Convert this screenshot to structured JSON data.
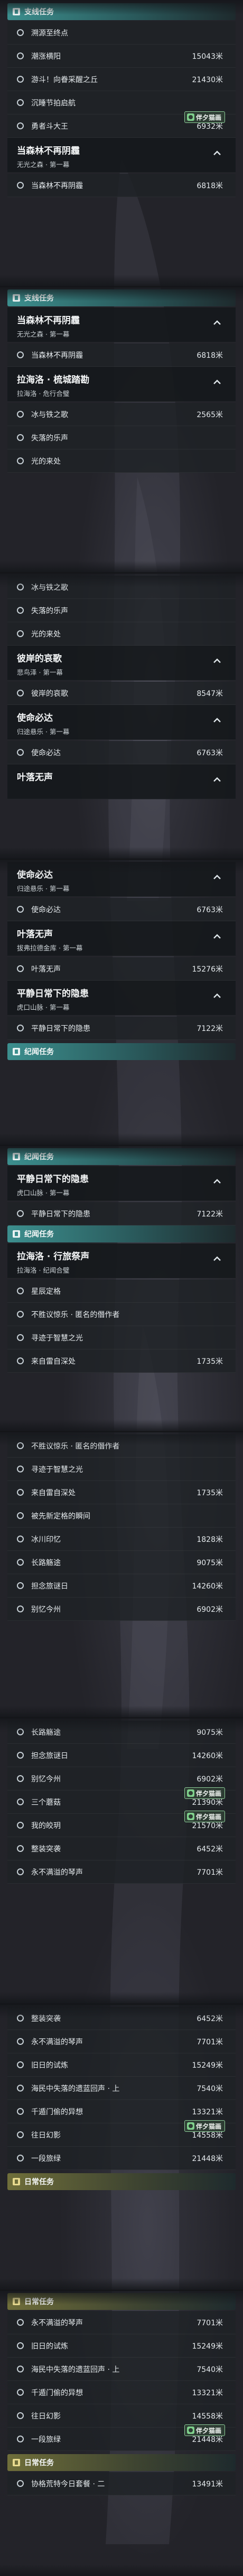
{
  "labels": {
    "sec_side": "支线任务",
    "sec_legend": "纪闻任务",
    "sec_daily": "日常任务"
  },
  "shots": [
    {
      "items": [
        {
          "name": "溯源至终点",
          "dist": ""
        },
        {
          "name": "潮涨横阳",
          "dist": "15043米"
        },
        {
          "name": "游斗！向眷采醒之丘",
          "dist": "21430米"
        },
        {
          "name": "沉睡节拍启航",
          "dist": ""
        },
        {
          "name": "勇者斗大王",
          "dist": "6932米",
          "badge": "伴夕猫画"
        }
      ],
      "section": "sec_side",
      "quest": {
        "title": "当森林不再阴霾",
        "sub": "无光之森 · 第一幕"
      },
      "after": [
        {
          "name": "当森林不再阴霾",
          "dist": "6818米"
        }
      ]
    },
    {
      "section": "sec_side",
      "quests": [
        {
          "title": "当森林不再阴霾",
          "sub": "无光之森 · 第一幕",
          "items": [
            {
              "name": "当森林不再阴霾",
              "dist": "6818米"
            }
          ]
        },
        {
          "title": "拉海洛 · 梳城踏勘",
          "sub": "拉海洛 · 危行合璧",
          "items": [
            {
              "name": "冰与铁之歌",
              "dist": "2565米"
            },
            {
              "name": "失落的乐声",
              "dist": ""
            },
            {
              "name": "光的来处",
              "dist": ""
            }
          ]
        }
      ]
    },
    {
      "items": [
        {
          "name": "冰与铁之歌",
          "dist": ""
        },
        {
          "name": "失落的乐声",
          "dist": ""
        },
        {
          "name": "光的来处",
          "dist": ""
        }
      ],
      "quests": [
        {
          "title": "彼岸的哀歌",
          "sub": "悲鸟泽 · 第一幕",
          "items": [
            {
              "name": "彼岸的哀歌",
              "dist": "8547米"
            }
          ]
        },
        {
          "title": "使命必达",
          "sub": "归途悬乐 · 第一幕",
          "items": [
            {
              "name": "使命必达",
              "dist": "6763米"
            }
          ]
        },
        {
          "title": "叶落无声",
          "sub": "",
          "items": []
        }
      ]
    },
    {
      "quests": [
        {
          "title": "使命必达",
          "sub": "归途悬乐 · 第一幕",
          "items": [
            {
              "name": "使命必达",
              "dist": "6763米"
            }
          ]
        },
        {
          "title": "叶落无声",
          "sub": "拔弗拉德金库 · 第一幕",
          "items": [
            {
              "name": "叶落无声",
              "dist": "15276米"
            }
          ]
        },
        {
          "title": "平静日常下的隐患",
          "sub": "虎口山脉 · 第一幕",
          "items": [
            {
              "name": "平静日常下的隐患",
              "dist": "7122米"
            }
          ]
        }
      ],
      "section_end": "sec_legend"
    },
    {
      "section": "sec_legend",
      "quests": [
        {
          "title": "平静日常下的隐患",
          "sub": "虎口山脉 · 第一幕",
          "items": [
            {
              "name": "平静日常下的隐患",
              "dist": "7122米"
            }
          ]
        }
      ],
      "section2": "sec_legend",
      "quest2": {
        "title": "拉海洛 · 行旅祭声",
        "sub": "拉海洛 · 纪闻合璧"
      },
      "items2": [
        {
          "name": "星辰定格",
          "dist": ""
        },
        {
          "name": "不胜议惊乐 · 匿名的僭作者",
          "dist": ""
        },
        {
          "name": "寻迹于智慧之光",
          "dist": ""
        },
        {
          "name": "来自雷自深处",
          "dist": "1735米"
        }
      ]
    },
    {
      "items": [
        {
          "name": "不胜议惊乐 · 匿名的僭作者",
          "dist": ""
        },
        {
          "name": "寻迹于智慧之光",
          "dist": ""
        },
        {
          "name": "来自雷自深处",
          "dist": "1735米"
        },
        {
          "name": "被先新定格的瞬间",
          "dist": ""
        },
        {
          "name": "冰川印忆",
          "dist": "1828米"
        },
        {
          "name": "长路觞途",
          "dist": "9075米"
        },
        {
          "name": "担念旅谜日",
          "dist": "14260米"
        },
        {
          "name": "别忆今州",
          "dist": "6902米"
        }
      ]
    },
    {
      "items": [
        {
          "name": "长路觞途",
          "dist": "9075米"
        },
        {
          "name": "担念旅谜日",
          "dist": "14260米"
        },
        {
          "name": "别忆今州",
          "dist": "6902米"
        },
        {
          "name": "三个蘑菇",
          "dist": "21390米",
          "badge": "伴夕猫画"
        },
        {
          "name": "我的皎玥",
          "dist": "21570米",
          "badge": "伴夕猫画"
        },
        {
          "name": "整装突袭",
          "dist": "6452米"
        },
        {
          "name": "永不满溢的琴声",
          "dist": "7701米"
        }
      ]
    },
    {
      "items": [
        {
          "name": "整装突袭",
          "dist": "6452米"
        },
        {
          "name": "永不满溢的琴声",
          "dist": "7701米"
        },
        {
          "name": "旧日的试炼",
          "dist": "15249米"
        },
        {
          "name": "海民中失落的遗蓝回声 · 上",
          "dist": "7540米"
        },
        {
          "name": "千遁门偷的异想",
          "dist": "13321米"
        },
        {
          "name": "往日幻影",
          "dist": "14558米",
          "badge": "伴夕猫画"
        },
        {
          "name": "一段旅绿",
          "dist": "21448米"
        }
      ],
      "section_end": "sec_daily"
    },
    {
      "section": "sec_daily",
      "items": [
        {
          "name": "永不满溢的琴声",
          "dist": "7701米"
        },
        {
          "name": "旧日的试炼",
          "dist": "15249米"
        },
        {
          "name": "海民中失落的遗蓝回声 · 上",
          "dist": "7540米"
        },
        {
          "name": "千遁门偷的异想",
          "dist": "13321米"
        },
        {
          "name": "往日幻影",
          "dist": "14558米"
        },
        {
          "name": "一段旅绿",
          "dist": "21448米",
          "badge": "伴夕猫画"
        }
      ],
      "section_end": "sec_daily",
      "end_item": {
        "name": "协格荒特今日套餐 · 二",
        "dist": "13491米"
      }
    }
  ]
}
